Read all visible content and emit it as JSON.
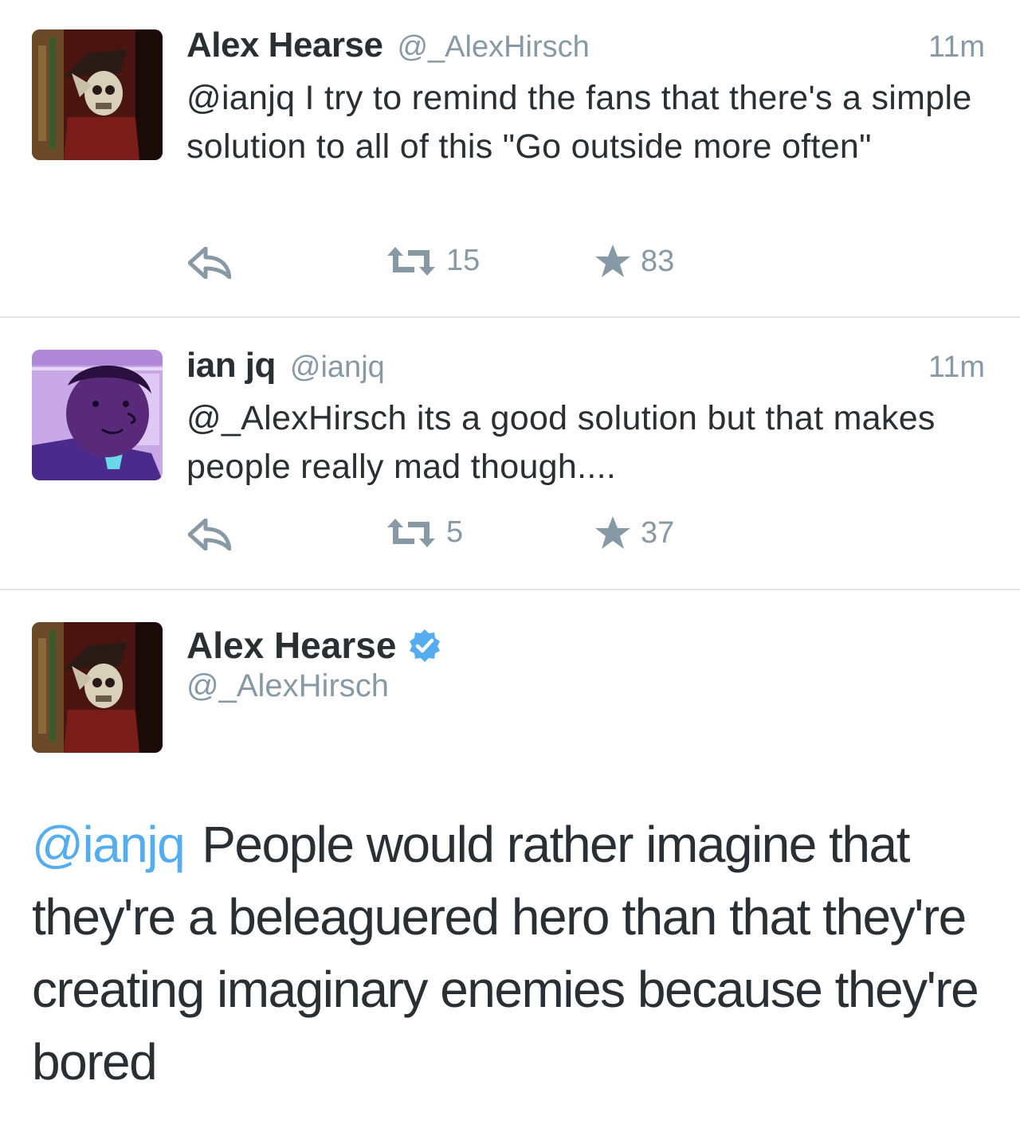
{
  "tweets": [
    {
      "name": "Alex Hearse",
      "handle": "@_AlexHirsch",
      "time": "11m",
      "text": "@ianjq I try to remind the fans that there's a simple solution to all of this \"Go outside more often\"",
      "retweets": "15",
      "favorites": "83",
      "avatar_icon": "skeleton-avatar-icon"
    },
    {
      "name": "ian jq",
      "handle": "@ianjq",
      "time": "11m",
      "text": "@_AlexHirsch its a good solution but that makes people really mad though....",
      "retweets": "5",
      "favorites": "37",
      "avatar_icon": "purple-character-avatar-icon"
    }
  ],
  "main_tweet": {
    "name": "Alex Hearse",
    "handle": "@_AlexHirsch",
    "mention": "@ianjq",
    "text": "People would rather imagine that they're a beleaguered hero than that they're creating imaginary enemies because they're bored",
    "verified_icon": "verified-badge-icon"
  },
  "colors": {
    "name": "#292f33",
    "meta": "#8899a6",
    "link": "#55acee",
    "divider": "#e1e8ed"
  }
}
